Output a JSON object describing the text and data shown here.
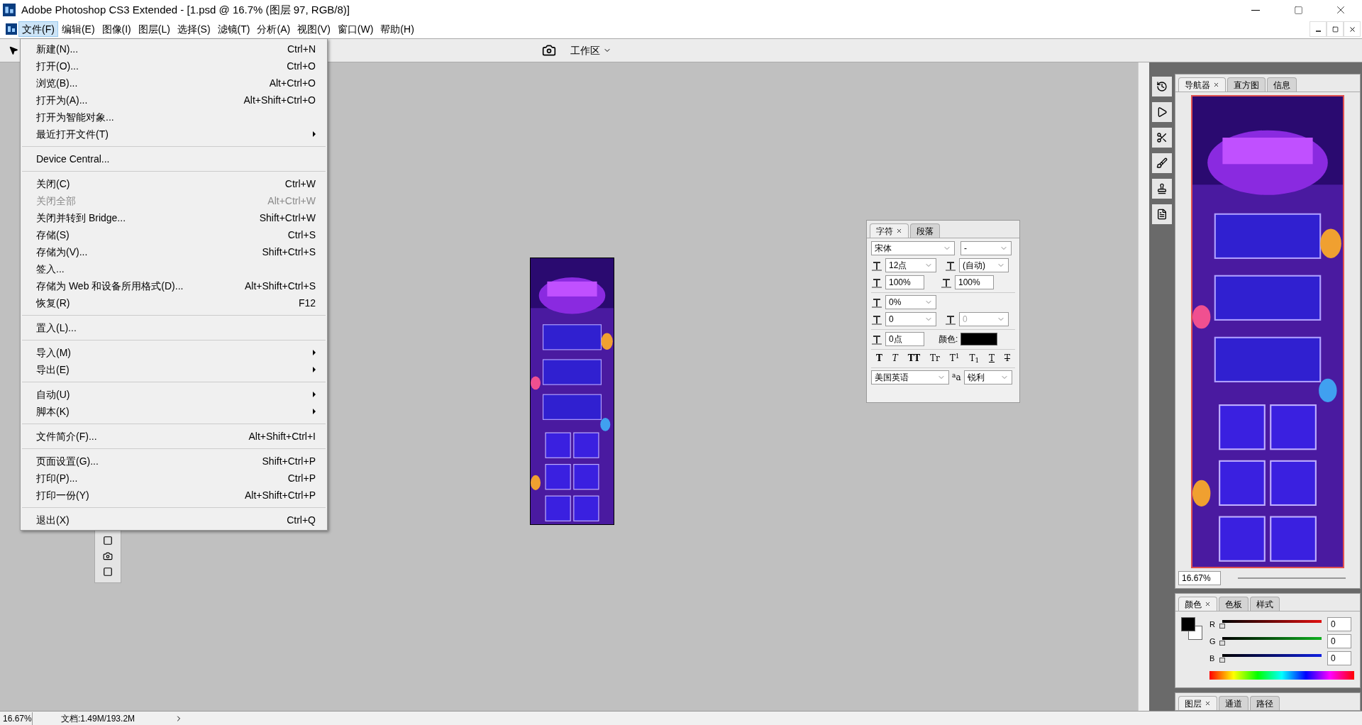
{
  "window": {
    "title": "Adobe Photoshop CS3 Extended - [1.psd @ 16.7% (图层 97, RGB/8)]"
  },
  "menu_bar": [
    {
      "label": "文件(F)",
      "selected": true
    },
    {
      "label": "编辑(E)",
      "selected": false
    },
    {
      "label": "图像(I)",
      "selected": false
    },
    {
      "label": "图层(L)",
      "selected": false
    },
    {
      "label": "选择(S)",
      "selected": false
    },
    {
      "label": "滤镜(T)",
      "selected": false
    },
    {
      "label": "分析(A)",
      "selected": false
    },
    {
      "label": "视图(V)",
      "selected": false
    },
    {
      "label": "窗口(W)",
      "selected": false
    },
    {
      "label": "帮助(H)",
      "selected": false
    }
  ],
  "options_bar": {
    "workspace": "工作区"
  },
  "file_menu": [
    {
      "kind": "item",
      "label": "新建(N)...",
      "shortcut": "Ctrl+N",
      "disabled": false
    },
    {
      "kind": "item",
      "label": "打开(O)...",
      "shortcut": "Ctrl+O",
      "disabled": false
    },
    {
      "kind": "item",
      "label": "浏览(B)...",
      "shortcut": "Alt+Ctrl+O",
      "disabled": false
    },
    {
      "kind": "item",
      "label": "打开为(A)...",
      "shortcut": "Alt+Shift+Ctrl+O",
      "disabled": false
    },
    {
      "kind": "item",
      "label": "打开为智能对象...",
      "disabled": false
    },
    {
      "kind": "submenu",
      "label": "最近打开文件(T)",
      "disabled": false
    },
    {
      "kind": "separator"
    },
    {
      "kind": "item",
      "label": "Device Central...",
      "disabled": false
    },
    {
      "kind": "separator"
    },
    {
      "kind": "item",
      "label": "关闭(C)",
      "shortcut": "Ctrl+W",
      "disabled": false
    },
    {
      "kind": "item",
      "label": "关闭全部",
      "shortcut": "Alt+Ctrl+W",
      "disabled": true
    },
    {
      "kind": "item",
      "label": "关闭并转到 Bridge...",
      "shortcut": "Shift+Ctrl+W",
      "disabled": false
    },
    {
      "kind": "item",
      "label": "存储(S)",
      "shortcut": "Ctrl+S",
      "disabled": false
    },
    {
      "kind": "item",
      "label": "存储为(V)...",
      "shortcut": "Shift+Ctrl+S",
      "disabled": false
    },
    {
      "kind": "item",
      "label": "签入...",
      "disabled": false
    },
    {
      "kind": "item",
      "label": "存储为 Web 和设备所用格式(D)...",
      "shortcut": "Alt+Shift+Ctrl+S",
      "disabled": false
    },
    {
      "kind": "item",
      "label": "恢复(R)",
      "shortcut": "F12",
      "disabled": false
    },
    {
      "kind": "separator"
    },
    {
      "kind": "item",
      "label": "置入(L)...",
      "disabled": false
    },
    {
      "kind": "separator"
    },
    {
      "kind": "submenu",
      "label": "导入(M)",
      "disabled": false
    },
    {
      "kind": "submenu",
      "label": "导出(E)",
      "disabled": false
    },
    {
      "kind": "separator"
    },
    {
      "kind": "submenu",
      "label": "自动(U)",
      "disabled": false
    },
    {
      "kind": "submenu",
      "label": "脚本(K)",
      "disabled": false
    },
    {
      "kind": "separator"
    },
    {
      "kind": "item",
      "label": "文件简介(F)...",
      "shortcut": "Alt+Shift+Ctrl+I",
      "disabled": false
    },
    {
      "kind": "separator"
    },
    {
      "kind": "item",
      "label": "页面设置(G)...",
      "shortcut": "Shift+Ctrl+P",
      "disabled": false
    },
    {
      "kind": "item",
      "label": "打印(P)...",
      "shortcut": "Ctrl+P",
      "disabled": false
    },
    {
      "kind": "item",
      "label": "打印一份(Y)",
      "shortcut": "Alt+Shift+Ctrl+P",
      "disabled": false
    },
    {
      "kind": "separator"
    },
    {
      "kind": "item",
      "label": "退出(X)",
      "shortcut": "Ctrl+Q",
      "disabled": false
    }
  ],
  "character_panel": {
    "tabs": [
      {
        "label": "字符",
        "selected": true
      },
      {
        "label": "段落",
        "selected": false
      }
    ],
    "font_family": "宋体",
    "font_style": "-",
    "size": "12点",
    "leading": "(自动)",
    "vertical_scale": "100%",
    "horizontal_scale": "100%",
    "tsume": "0%",
    "kerning": "0",
    "tracking": "0",
    "baseline": "0点",
    "color_label": "颜色:",
    "color": "#000000",
    "style_buttons": [
      {
        "kind": "bold",
        "label": "T"
      },
      {
        "kind": "italic",
        "label": "T"
      },
      {
        "kind": "caps",
        "label": "TT"
      },
      {
        "kind": "smallcaps",
        "label": "Tr"
      },
      {
        "kind": "super",
        "label": "T$^{1}$"
      },
      {
        "kind": "sub",
        "label": "T$_{1}$"
      },
      {
        "kind": "underline",
        "label": "T"
      },
      {
        "kind": "strike",
        "label": "T"
      }
    ],
    "language": "美国英语",
    "antialias_label": "$^{a}$a",
    "antialias": "锐利"
  },
  "navigator_panel": {
    "tabs": [
      {
        "label": "导航器",
        "selected": true
      },
      {
        "label": "直方图",
        "selected": false
      },
      {
        "label": "信息",
        "selected": false
      }
    ],
    "zoom": "16.67%"
  },
  "color_panel": {
    "tabs": [
      {
        "label": "颜色",
        "selected": true
      },
      {
        "label": "色板",
        "selected": false
      },
      {
        "label": "样式",
        "selected": false
      }
    ],
    "channels": [
      {
        "name": "R",
        "value": "0",
        "level": 0
      },
      {
        "name": "G",
        "value": "0",
        "level": 0
      },
      {
        "name": "B",
        "value": "0",
        "level": 0
      }
    ]
  },
  "layers_panel": {
    "tabs": [
      {
        "label": "图层",
        "selected": true
      },
      {
        "label": "通道",
        "selected": false
      },
      {
        "label": "路径",
        "selected": false
      }
    ]
  },
  "status_bar": {
    "zoom": "16.67%",
    "document": "文档:1.49M/193.2M"
  }
}
